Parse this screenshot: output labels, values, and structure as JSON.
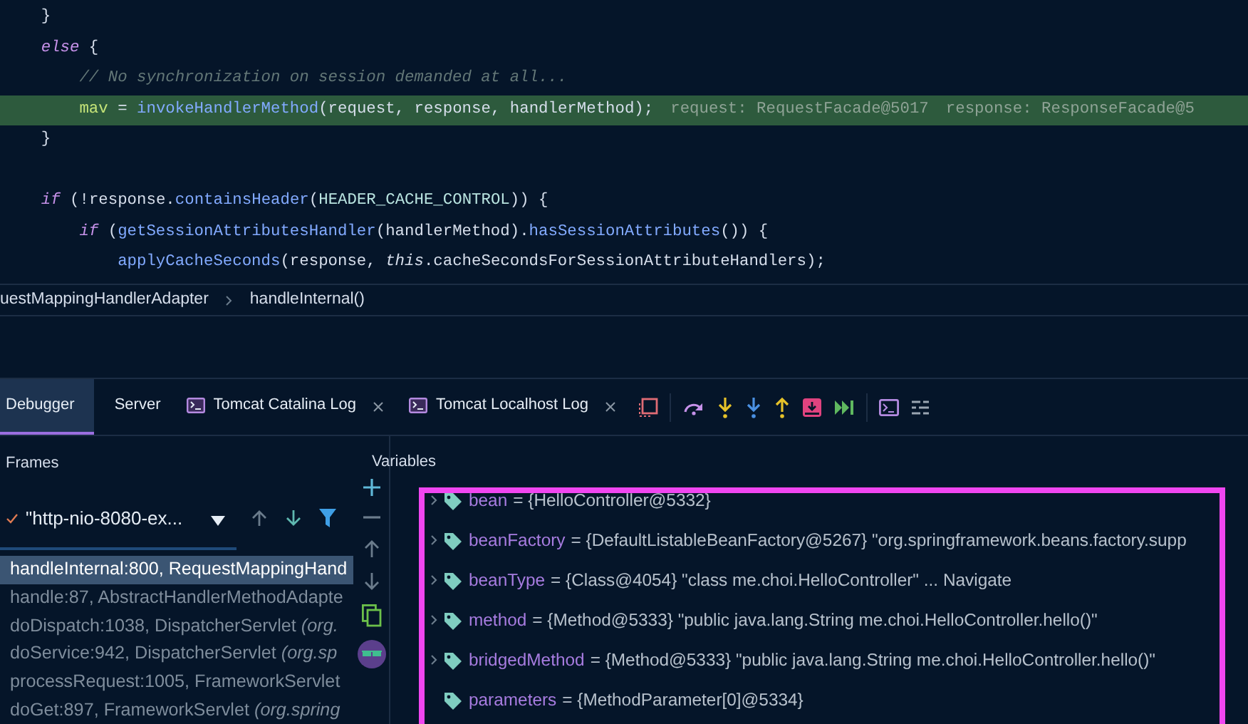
{
  "editor": {
    "lines": [
      {
        "kind": "code",
        "tokens": [
          {
            "kind": "punct",
            "text": "    }"
          }
        ]
      },
      {
        "kind": "code",
        "tokens": [
          {
            "kind": "kw",
            "text": "    else"
          },
          {
            "kind": "punct",
            "text": " {"
          }
        ]
      },
      {
        "kind": "code",
        "tokens": [
          {
            "kind": "comment",
            "text": "        // No synchronization on session demanded at all..."
          }
        ]
      },
      {
        "kind": "code",
        "highlighted": true,
        "tokens": [
          {
            "kind": "var",
            "text": "        mav"
          },
          {
            "kind": "punct",
            "text": " = "
          },
          {
            "kind": "fn",
            "text": "invokeHandlerMethod"
          },
          {
            "kind": "punct",
            "text": "("
          },
          {
            "kind": "plain",
            "text": "request"
          },
          {
            "kind": "punct",
            "text": ", "
          },
          {
            "kind": "plain",
            "text": "response"
          },
          {
            "kind": "punct",
            "text": ", "
          },
          {
            "kind": "plain",
            "text": "handlerMethod"
          },
          {
            "kind": "punct",
            "text": ");"
          }
        ],
        "hints": [
          "request: RequestFacade@5017",
          "response: ResponseFacade@5"
        ]
      },
      {
        "kind": "code",
        "tokens": [
          {
            "kind": "punct",
            "text": "    }"
          }
        ]
      },
      {
        "kind": "blank"
      },
      {
        "kind": "code",
        "tokens": [
          {
            "kind": "kw",
            "text": "    if"
          },
          {
            "kind": "punct",
            "text": " (!"
          },
          {
            "kind": "plain",
            "text": "response"
          },
          {
            "kind": "punct",
            "text": "."
          },
          {
            "kind": "fn",
            "text": "containsHeader"
          },
          {
            "kind": "punct",
            "text": "("
          },
          {
            "kind": "const",
            "text": "HEADER_CACHE_CONTROL"
          },
          {
            "kind": "punct",
            "text": ")) {"
          }
        ]
      },
      {
        "kind": "code",
        "tokens": [
          {
            "kind": "kw",
            "text": "        if"
          },
          {
            "kind": "punct",
            "text": " ("
          },
          {
            "kind": "fn",
            "text": "getSessionAttributesHandler"
          },
          {
            "kind": "punct",
            "text": "("
          },
          {
            "kind": "plain",
            "text": "handlerMethod"
          },
          {
            "kind": "punct",
            "text": ")."
          },
          {
            "kind": "fn",
            "text": "hasSessionAttributes"
          },
          {
            "kind": "punct",
            "text": "()) {"
          }
        ]
      },
      {
        "kind": "code",
        "tokens": [
          {
            "kind": "fn",
            "text": "            applyCacheSeconds"
          },
          {
            "kind": "punct",
            "text": "("
          },
          {
            "kind": "plain",
            "text": "response"
          },
          {
            "kind": "punct",
            "text": ", "
          },
          {
            "kind": "this",
            "text": "this"
          },
          {
            "kind": "punct",
            "text": "."
          },
          {
            "kind": "plain",
            "text": "cacheSecondsForSessionAttributeHandlers"
          },
          {
            "kind": "punct",
            "text": ");"
          }
        ]
      }
    ]
  },
  "breadcrumb": {
    "items": [
      "uestMappingHandlerAdapter",
      "handleInternal()"
    ]
  },
  "tabs": [
    {
      "label": "Debugger",
      "selected": true,
      "kind": "plain",
      "closable": false
    },
    {
      "label": "Server",
      "selected": false,
      "kind": "plain",
      "closable": false
    },
    {
      "label": "Tomcat Catalina Log",
      "selected": false,
      "kind": "console",
      "closable": true
    },
    {
      "label": "Tomcat Localhost Log",
      "selected": false,
      "kind": "console",
      "closable": true
    }
  ],
  "frames": {
    "title": "Frames",
    "thread": "\"http-nio-8080-ex...",
    "items": [
      {
        "text": "handleInternal:800, RequestMappingHand",
        "selected": true
      },
      {
        "text": "handle:87, AbstractHandlerMethodAdapte",
        "selected": false
      },
      {
        "text": "doDispatch:1038, DispatcherServlet *(org.*",
        "selected": false
      },
      {
        "text": "doService:942, DispatcherServlet *(org.sp*",
        "selected": false
      },
      {
        "text": "processRequest:1005, FrameworkServlet",
        "selected": false
      },
      {
        "text": "doGet:897, FrameworkServlet *(org.spring*",
        "selected": false
      }
    ]
  },
  "variables": {
    "title": "Variables",
    "items": [
      {
        "name": "bean",
        "value": "= {HelloController@5332}",
        "expandable": true
      },
      {
        "name": "beanFactory",
        "value": "= {DefaultListableBeanFactory@5267} \"org.springframework.beans.factory.supp",
        "expandable": true
      },
      {
        "name": "beanType",
        "value": "= {Class@4054} \"class me.choi.HelloController\" ... Navigate",
        "expandable": true
      },
      {
        "name": "method",
        "value": "= {Method@5333} \"public java.lang.String me.choi.HelloController.hello()\"",
        "expandable": true
      },
      {
        "name": "bridgedMethod",
        "value": "= {Method@5333} \"public java.lang.String me.choi.HelloController.hello()\"",
        "expandable": true
      },
      {
        "name": "parameters",
        "value": "= {MethodParameter[0]@5334}",
        "expandable": false
      }
    ]
  }
}
